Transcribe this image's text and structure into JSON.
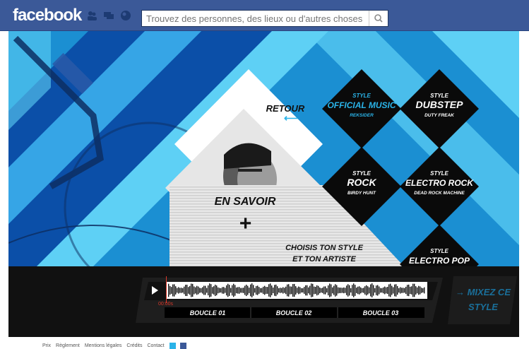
{
  "fb": {
    "logo": "facebook",
    "search_placeholder": "Trouvez des personnes, des lieux ou d'autres choses",
    "icons": [
      "friends-icon",
      "messages-icon",
      "notifications-icon",
      "search-icon"
    ]
  },
  "nav": {
    "back": "RETOUR",
    "learn_more": "EN SAVOIR",
    "plus": "+",
    "choose_line1": "CHOISIS TON STYLE",
    "choose_line2": "ET TON ARTISTE"
  },
  "styles": [
    {
      "style_label": "STYLE",
      "name": "OFFICIAL MUSIC",
      "artist": "REKSIDER",
      "highlight": true
    },
    {
      "style_label": "STYLE",
      "name": "DUBSTEP",
      "artist": "DUTY FREAK",
      "highlight": false
    },
    {
      "style_label": "STYLE",
      "name": "ROCK",
      "artist": "BIRDY HUNT",
      "highlight": false
    },
    {
      "style_label": "STYLE",
      "name": "ELECTRO ROCK",
      "artist": "DEAD ROCK MACHINE",
      "highlight": false
    },
    {
      "style_label": "STYLE",
      "name": "ELECTRO POP",
      "artist": "",
      "highlight": false
    }
  ],
  "player": {
    "time": "00:00s",
    "loops": [
      "BOUCLE 01",
      "BOUCLE 02",
      "BOUCLE 03"
    ],
    "mix_line1": "→ MIXEZ CE",
    "mix_line2": "STYLE"
  },
  "footer": {
    "links": [
      "Prix",
      "Règlement",
      "Mentions légales",
      "Crédits",
      "Contact"
    ]
  },
  "colors": {
    "fb_blue": "#3b5998",
    "light_cyan": "#5ed0f5",
    "mid_blue": "#1b8fd2",
    "deep_blue": "#0b4fa8",
    "accent": "#2ab3e8",
    "black": "#0a0a0a"
  }
}
